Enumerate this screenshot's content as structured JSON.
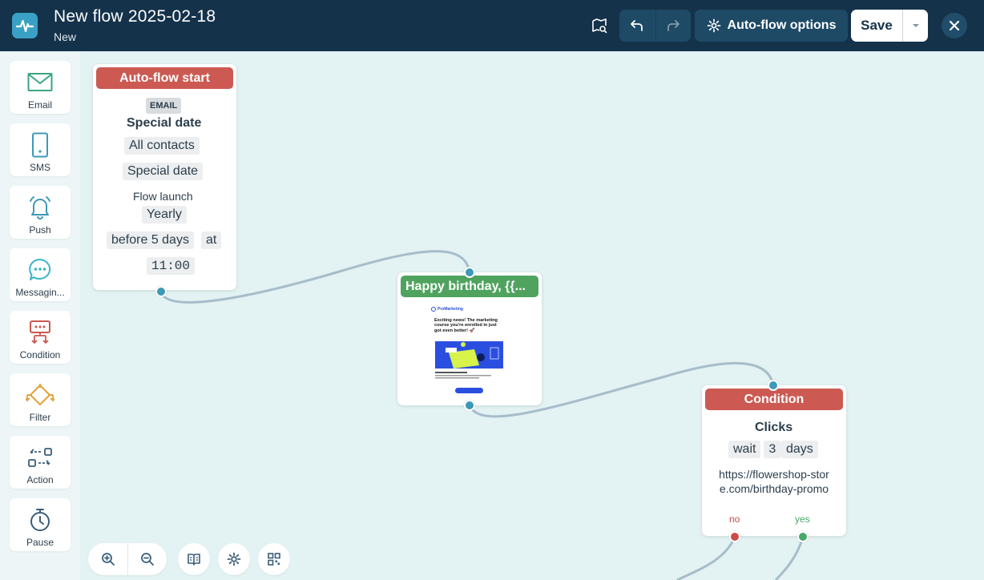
{
  "header": {
    "title": "New flow 2025-02-18",
    "status": "New",
    "auto_flow_label": "Auto-flow options",
    "save_label": "Save"
  },
  "sidebar": {
    "items": [
      {
        "label": "Email",
        "icon": "envelope-icon"
      },
      {
        "label": "SMS",
        "icon": "phone-icon"
      },
      {
        "label": "Push",
        "icon": "bell-icon"
      },
      {
        "label": "Messagin...",
        "icon": "chat-bubble-icon"
      },
      {
        "label": "Condition",
        "icon": "condition-icon"
      },
      {
        "label": "Filter",
        "icon": "filter-icon"
      },
      {
        "label": "Action",
        "icon": "action-icon"
      },
      {
        "label": "Pause",
        "icon": "stopwatch-icon"
      }
    ]
  },
  "nodes": {
    "start": {
      "header": "Auto-flow start",
      "badge": "EMAIL",
      "title": "Special date",
      "audience": "All contacts",
      "trigger": "Special date",
      "launch_label": "Flow launch",
      "frequency": "Yearly",
      "offset": "before 5 days",
      "at_label": "at",
      "time": "11:00"
    },
    "email": {
      "header": "Happy birthday, {{...",
      "preview_brand": "ProMarketing",
      "preview_headline": "Exciting news! The marketing course you're enrolled in just got even better! 🚀"
    },
    "condition": {
      "header": "Condition",
      "title": "Clicks",
      "wait_label": "wait",
      "wait_value": "3",
      "days_label": "days",
      "url": "https://flowershop-store.com/birthday-promo",
      "no_label": "no",
      "yes_label": "yes"
    }
  },
  "colors": {
    "header_bg": "#14324a",
    "canvas_bg": "#e3f2f2",
    "red_header": "#cc5a52",
    "green_header": "#4fa35e",
    "port_blue": "#3e98b8"
  }
}
